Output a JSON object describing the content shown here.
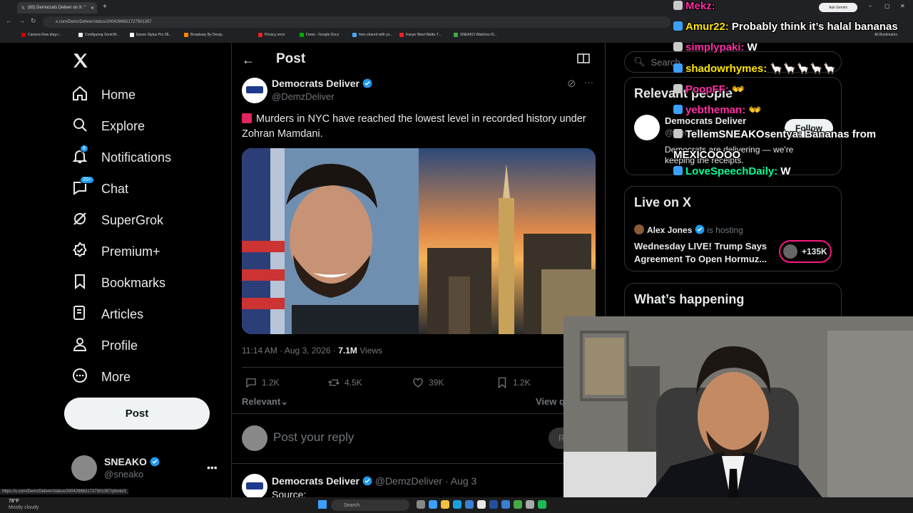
{
  "browser": {
    "tab_title": "(83) Democrats Deliver on X: \"",
    "url": "x.com/DemzDeliver/status/2004298631727501357",
    "gemini_label": "Ask Gemini",
    "all_bookmarks": "All Bookmarks",
    "bookmarks": [
      "Camera Raw plug-i...",
      "Configuring SonicW...",
      "Epson Stylus Pro 38...",
      "Broadway By Desig...",
      "Privacy error",
      "Fame - Google Docs",
      "Item shared with yo...",
      "Kanye West Walks T...",
      "SNEAKO Watches IS..."
    ]
  },
  "sidebar": {
    "items": [
      {
        "label": "Home",
        "icon": "home-icon"
      },
      {
        "label": "Explore",
        "icon": "search-icon"
      },
      {
        "label": "Notifications",
        "icon": "bell-icon",
        "badge": "8"
      },
      {
        "label": "Chat",
        "icon": "chat-icon",
        "badge": "20+"
      },
      {
        "label": "SuperGrok",
        "icon": "grok-icon"
      },
      {
        "label": "Premium+",
        "icon": "premium-icon"
      },
      {
        "label": "Bookmarks",
        "icon": "bookmark-icon"
      },
      {
        "label": "Articles",
        "icon": "articles-icon"
      },
      {
        "label": "Profile",
        "icon": "profile-icon"
      },
      {
        "label": "More",
        "icon": "more-icon"
      }
    ],
    "post_button": "Post",
    "account": {
      "name": "SNEAKO",
      "handle": "@sneako"
    }
  },
  "post": {
    "header_title": "Post",
    "author_name": "Democrats Deliver",
    "author_handle": "@DemzDeliver",
    "text": "Murders in NYC have reached the lowest level in recorded history under Zohran Mamdani.",
    "time": "11:14 AM · Aug 3, 2026 · ",
    "views": "7.1M",
    "views_label": "Views",
    "replies": "1.2K",
    "reposts": "4.5K",
    "likes": "39K",
    "bookmarks": "1.2K",
    "sort_label": "Relevant",
    "view_quotes": "View q",
    "reply_placeholder": "Post your reply",
    "reply_button": "R",
    "reply_author_name": "Democrats Deliver",
    "reply_author_handle": "@DemzDeliver · Aug 3",
    "reply_text": "Source:"
  },
  "right": {
    "search_placeholder": "Search",
    "relevant_title": "Relevant people",
    "relevant_name": "Democrats Deliver",
    "relevant_handle": "@DemzDeliver",
    "relevant_bio": "Democrats are delivering — we're keeping the receipts.",
    "follow_label": "Follow",
    "live_title": "Live on X",
    "live_host": "Alex Jones",
    "live_hosting": "is hosting",
    "live_text": "Wednesday LIVE! Trump Says Agreement To Open Hormuz...",
    "live_count": "+135K",
    "happening_title": "What’s happening"
  },
  "stream_chat": [
    {
      "user": "Mekz:",
      "msg": "",
      "color": "#ff2ea6"
    },
    {
      "user": "Amur22:",
      "msg": "Probably think it’s halal bananas",
      "color": "#ffe600"
    },
    {
      "user": "simplypaki:",
      "msg": "W",
      "color": "#ff2ea6"
    },
    {
      "user": "shadowrhymes:",
      "msg": "🦙🦙🦙🦙🦙",
      "color": "#ffe600"
    },
    {
      "user": "PoopFF:",
      "msg": "👐",
      "color": "#ff2ea6"
    },
    {
      "user": "yebtheman:",
      "msg": "👐",
      "color": "#ff2ea6"
    },
    {
      "user": "TellemSNEAKOsentya:",
      "msg": "Bananas from MEXICOOOO",
      "color": "#ffffff"
    },
    {
      "user": "LoveSpeechDaily:",
      "msg": "W",
      "color": "#00ff99"
    }
  ],
  "taskbar": {
    "search_label": "Search",
    "weather_temp": "78°F",
    "weather_desc": "Mostly cloudy",
    "status_url": "https://x.com/DemzDeliver/status/2004298631727501357/photo/1"
  },
  "colors": {
    "accent": "#1d9bf0",
    "bg": "#000000",
    "text": "#e7e9ea",
    "muted": "#71767b"
  }
}
